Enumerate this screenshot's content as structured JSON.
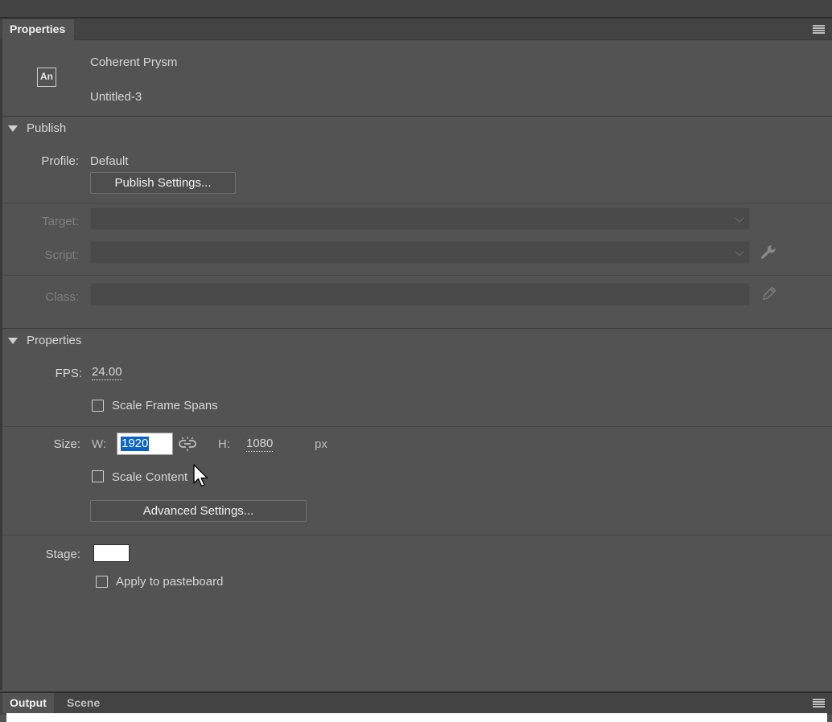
{
  "panel": {
    "tab_label": "Properties",
    "doc_icon_text": "An",
    "doc_type": "Coherent Prysm",
    "doc_name": "Untitled-3"
  },
  "publish": {
    "section_label": "Publish",
    "profile_label": "Profile:",
    "profile_value": "Default",
    "settings_button": "Publish Settings...",
    "target_label": "Target:",
    "target_value": "",
    "script_label": "Script:",
    "script_value": "",
    "class_label": "Class:",
    "class_value": ""
  },
  "properties": {
    "section_label": "Properties",
    "fps_label": "FPS:",
    "fps_value": "24.00",
    "scale_frame_spans_label": "Scale Frame Spans",
    "scale_frame_spans_checked": false,
    "size_label": "Size:",
    "w_label": "W:",
    "w_value": "1920",
    "h_label": "H:",
    "h_value": "1080",
    "unit": "px",
    "scale_content_label": "Scale Content",
    "scale_content_checked": false,
    "advanced_button": "Advanced Settings...",
    "stage_label": "Stage:",
    "stage_color": "#ffffff",
    "apply_pasteboard_label": "Apply to pasteboard",
    "apply_pasteboard_checked": false
  },
  "bottom": {
    "tabs": [
      {
        "label": "Output",
        "active": true
      },
      {
        "label": "Scene",
        "active": false
      }
    ]
  },
  "colors": {
    "panel_bg": "#535353",
    "tabbar_bg": "#434343",
    "selection": "#0a64c8"
  }
}
